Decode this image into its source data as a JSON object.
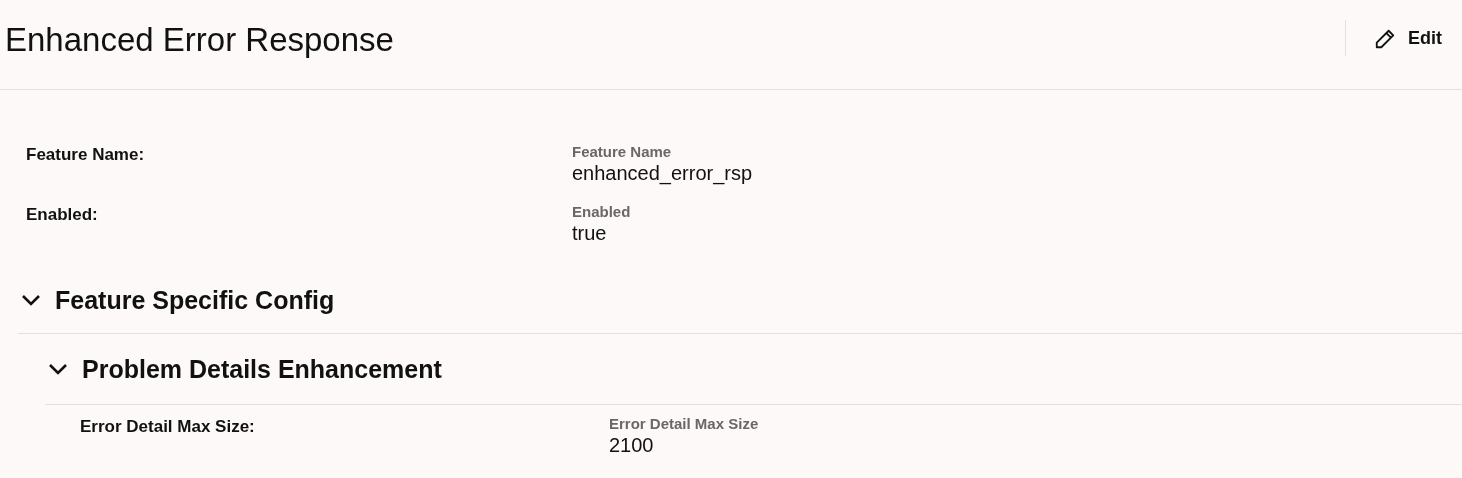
{
  "header": {
    "title": "Enhanced Error Response",
    "edit_button": "Edit"
  },
  "fields": [
    {
      "label": "Feature Name:",
      "caption": "Feature Name",
      "value": "enhanced_error_rsp"
    },
    {
      "label": "Enabled:",
      "caption": "Enabled",
      "value": "true"
    }
  ],
  "sections": [
    {
      "title": "Feature Specific Config",
      "expanded": true,
      "subsections": [
        {
          "title": "Problem Details Enhancement",
          "expanded": true,
          "fields": [
            {
              "label": "Error Detail Max Size:",
              "caption": "Error Detail Max Size",
              "value": "2100"
            }
          ]
        }
      ]
    }
  ]
}
